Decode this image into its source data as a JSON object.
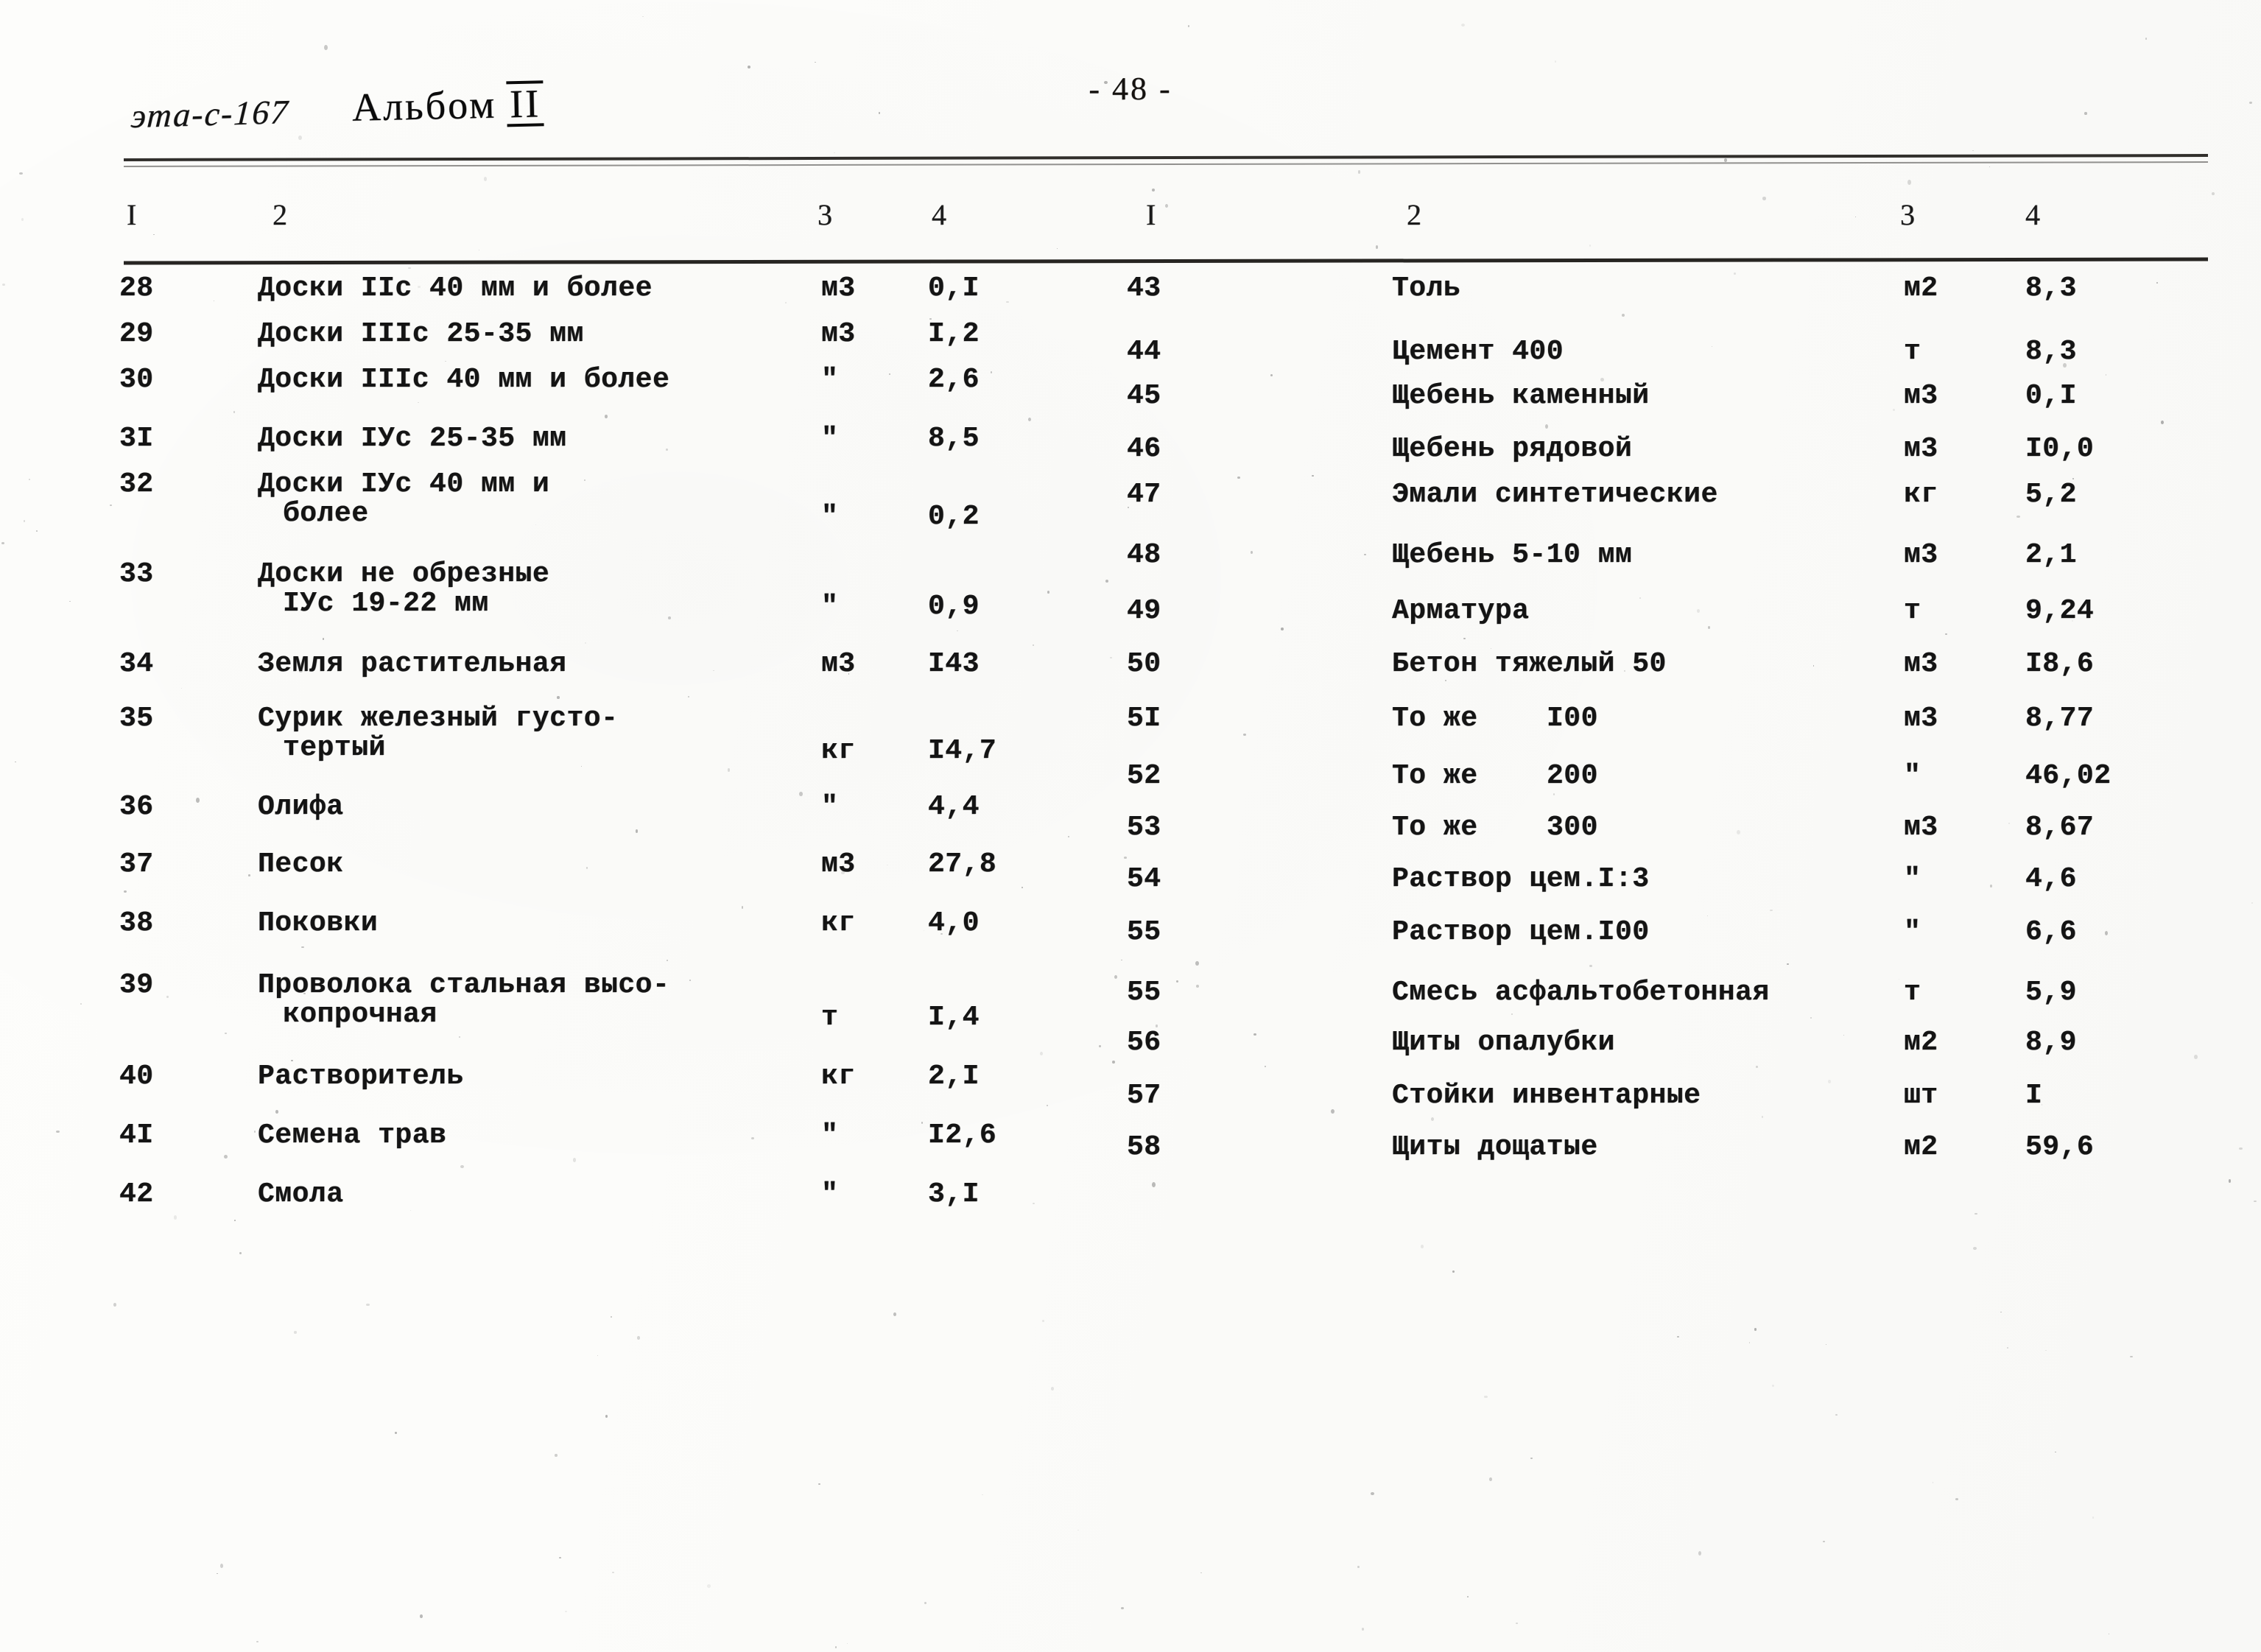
{
  "page": {
    "number_label": "- 48 -",
    "doc_code": "эта-с-167",
    "album_label": "Альбом",
    "album_number": "II"
  },
  "table": {
    "columns": [
      "I",
      "2",
      "3",
      "4"
    ],
    "left": [
      {
        "no": "28",
        "name": "Доски IIс 40 мм и более",
        "name2": "",
        "unit": "м3",
        "qty": "0,I"
      },
      {
        "no": "29",
        "name": "Доски IIIс 25-35 мм",
        "name2": "",
        "unit": "м3",
        "qty": "I,2"
      },
      {
        "no": "30",
        "name": "Доски IIIс 40 мм и более",
        "name2": "",
        "unit": "\"",
        "qty": "2,6"
      },
      {
        "no": "3I",
        "name": "Доски IУс 25-35 мм",
        "name2": "",
        "unit": "\"",
        "qty": "8,5"
      },
      {
        "no": "32",
        "name": "Доски IУс 40 мм и",
        "name2": "более",
        "unit": "\"",
        "qty": "0,2"
      },
      {
        "no": "33",
        "name": "Доски не обрезные",
        "name2": "IУс 19-22 мм",
        "unit": "\"",
        "qty": "0,9"
      },
      {
        "no": "34",
        "name": "Земля растительная",
        "name2": "",
        "unit": "м3",
        "qty": "I43"
      },
      {
        "no": "35",
        "name": "Сурик железный густо-",
        "name2": "тертый",
        "unit": "кг",
        "qty": "I4,7"
      },
      {
        "no": "36",
        "name": "Олифа",
        "name2": "",
        "unit": "\"",
        "qty": "4,4"
      },
      {
        "no": "37",
        "name": "Песок",
        "name2": "",
        "unit": "м3",
        "qty": "27,8"
      },
      {
        "no": "38",
        "name": "Поковки",
        "name2": "",
        "unit": "кг",
        "qty": "4,0"
      },
      {
        "no": "39",
        "name": "Проволока стальная высо-",
        "name2": "копрочная",
        "unit": "т",
        "qty": "I,4"
      },
      {
        "no": "40",
        "name": "Растворитель",
        "name2": "",
        "unit": "кг",
        "qty": "2,I"
      },
      {
        "no": "4I",
        "name": "Семена трав",
        "name2": "",
        "unit": "\"",
        "qty": "I2,6"
      },
      {
        "no": "42",
        "name": "Смола",
        "name2": "",
        "unit": "\"",
        "qty": "3,I"
      }
    ],
    "right": [
      {
        "no": "43",
        "name": "Толь",
        "qualifier": "",
        "unit": "м2",
        "qty": "8,3"
      },
      {
        "no": "44",
        "name": "Цемент 400",
        "qualifier": "",
        "unit": "т",
        "qty": "8,3"
      },
      {
        "no": "45",
        "name": "Щебень каменный",
        "qualifier": "",
        "unit": "м3",
        "qty": "0,I"
      },
      {
        "no": "46",
        "name": "Щебень рядовой",
        "qualifier": "",
        "unit": "м3",
        "qty": "I0,0"
      },
      {
        "no": "47",
        "name": "Эмали синтетические",
        "qualifier": "",
        "unit": "кг",
        "qty": "5,2"
      },
      {
        "no": "48",
        "name": "Щебень 5-10 мм",
        "qualifier": "",
        "unit": "м3",
        "qty": "2,1"
      },
      {
        "no": "49",
        "name": "Арматура",
        "qualifier": "",
        "unit": "т",
        "qty": "9,24"
      },
      {
        "no": "50",
        "name": "Бетон тяжелый 50",
        "qualifier": "",
        "unit": "м3",
        "qty": "I8,6"
      },
      {
        "no": "5I",
        "name": "То же",
        "qualifier": "I00",
        "unit": "м3",
        "qty": "8,77"
      },
      {
        "no": "52",
        "name": "То же",
        "qualifier": "200",
        "unit": "\"",
        "qty": "46,02"
      },
      {
        "no": "53",
        "name": "То же",
        "qualifier": "300",
        "unit": "м3",
        "qty": "8,67"
      },
      {
        "no": "54",
        "name": "Раствор цем.I:3",
        "qualifier": "",
        "unit": "\"",
        "qty": "4,6"
      },
      {
        "no": "55",
        "name": "Раствор цем.I00",
        "qualifier": "",
        "unit": "\"",
        "qty": "6,6"
      },
      {
        "no": "55",
        "name": "Смесь асфальтобетонная",
        "qualifier": "",
        "unit": "т",
        "qty": "5,9"
      },
      {
        "no": "56",
        "name": "Щиты опалубки",
        "qualifier": "",
        "unit": "м2",
        "qty": "8,9"
      },
      {
        "no": "57",
        "name": "Стойки инвентарные",
        "qualifier": "",
        "unit": "шт",
        "qty": "I"
      },
      {
        "no": "58",
        "name": "Щиты дощатые",
        "qualifier": "",
        "unit": "м2",
        "qty": "59,6"
      }
    ]
  }
}
